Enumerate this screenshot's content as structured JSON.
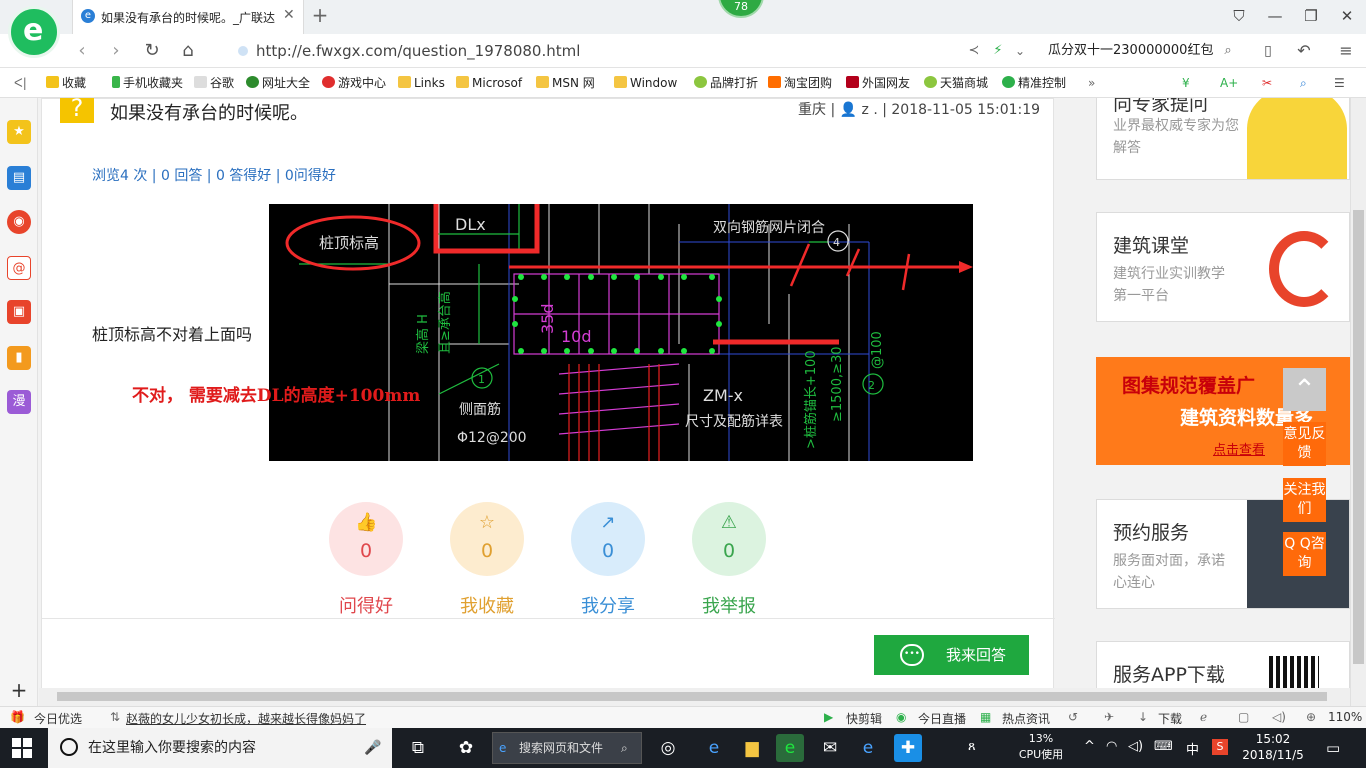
{
  "browser": {
    "tab_title": "如果没有承台的时候呢。_广联达",
    "notification_count": "78",
    "url": "http://e.fwxgx.com/question_1978080.html",
    "search_text": "瓜分双十一230000000红包"
  },
  "bookmarks": [
    "收藏",
    "手机收藏夹",
    "谷歌",
    "网址大全",
    "游戏中心",
    "Links",
    "Microsof",
    "MSN 网",
    "Window",
    "品牌打折",
    "淘宝团购",
    "外国网友",
    "天猫商城",
    "精准控制"
  ],
  "question": {
    "title": "如果没有承台的时候呢。",
    "location": "重庆",
    "user": "z .",
    "datetime": "2018-11-05 15:01:19",
    "stats": "浏览4 次 | 0 回答 | 0 答得好 | 0问得好",
    "body": "桩顶标高不对着上面吗",
    "answer_overlay": "不对， 需要减去DL的高度+100mm"
  },
  "drawing_labels": {
    "dlx": "DLx",
    "pile_top": "桩顶标高",
    "mesh": "双向钢筋网片闭合",
    "circle4": "4",
    "circle1": "1",
    "circle2": "2",
    "d35": "35d",
    "d10": "10d",
    "zm": "ZM-x",
    "size": "尺寸及配筋详表",
    "side_bar": "侧面筋",
    "phi": "Φ12@200",
    "vtext1": "梁高 H",
    "vtext2": "且≥承台高",
    "vtext3": ">桩筋锚长+100",
    "vtext4": "≥1500,≥30",
    "vtext5": "@100"
  },
  "actions": [
    {
      "label": "问得好",
      "count": "0",
      "color": "#e0474c",
      "bg": "#fde3e3",
      "icon": "👍"
    },
    {
      "label": "我收藏",
      "count": "0",
      "color": "#e0a030",
      "bg": "#fdeccf",
      "icon": "☆"
    },
    {
      "label": "我分享",
      "count": "0",
      "color": "#3a8fd6",
      "bg": "#d8ecfb",
      "icon": "↗"
    },
    {
      "label": "我举报",
      "count": "0",
      "color": "#3aa54e",
      "bg": "#dcf3e0",
      "icon": "⚠"
    }
  ],
  "reply_button": "我来回答",
  "right_column": {
    "expert_title": "向专家提问",
    "expert_sub": "业界最权威专家为您解答",
    "class_title": "建筑课堂",
    "class_sub": "建筑行业实训教学第一平台",
    "promo_line1": "图集规范覆盖广",
    "promo_line2": "建筑资料数量多",
    "promo_link": "点击查看",
    "booking_title": "预约服务",
    "booking_sub": "服务面对面，承诺心连心",
    "app_title": "服务APP下载"
  },
  "float_buttons": [
    "意见反馈",
    "关注我们",
    "Q Q咨询"
  ],
  "statusbar": {
    "left": "今日优选",
    "news": "赵薇的女儿少女初长成，越来越长得像妈妈了",
    "items": [
      "快剪辑",
      "今日直播",
      "热点资讯",
      "下载"
    ],
    "zoom": "110%"
  },
  "taskbar": {
    "search_placeholder": "在这里输入你要搜索的内容",
    "ie_search": "搜索网页和文件",
    "cpu_percent": "13%",
    "cpu_label": "CPU使用",
    "ime": "中",
    "time": "15:02",
    "date": "2018/11/5"
  },
  "colors": {
    "brand_green": "#1fbd5f",
    "reply_green": "#1fa83f",
    "answer_red": "#e01b1b",
    "promo_orange": "#ff7a1a",
    "float_orange": "#ff6a0a"
  }
}
